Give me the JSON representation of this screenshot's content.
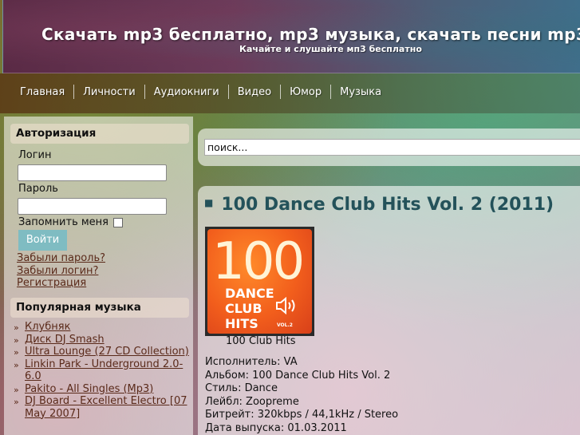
{
  "header": {
    "title": "Скачать mp3 бесплатно, mp3 музыка, скачать песни mp3",
    "subtitle": "Качайте и слушайте мп3 бесплатно"
  },
  "nav": [
    "Главная",
    "Личности",
    "Аудиокниги",
    "Видео",
    "Юмор",
    "Музыка"
  ],
  "auth": {
    "title": "Авторизация",
    "login_label": "Логин",
    "password_label": "Пароль",
    "remember_label": "Запомнить меня",
    "login_button": "Войти",
    "forgot_password": "Забыли пароль?",
    "forgot_login": "Забыли логин?",
    "register": "Регистрация"
  },
  "popular": {
    "title": "Популярная музыка",
    "items": [
      "Клубняк",
      "Диск DJ Smash",
      "Ultra Lounge (27 CD Collection)",
      "Linkin Park - Underground 2.0-6.0",
      "Pakito - All Singles (Mp3)",
      "DJ Board - Excellent Electro [07 May 2007]"
    ]
  },
  "search": {
    "value": "поиск..."
  },
  "article": {
    "title": "100 Dance Club Hits Vol. 2 (2011)",
    "cover": {
      "number": "100",
      "line1": "DANCE",
      "line2": "CLUB",
      "line3": "HITS",
      "vol": "VOL.2",
      "caption": "100 Club Hits"
    },
    "info": [
      "Исполнитель: VA",
      "Альбом: 100 Dance Club Hits Vol. 2",
      "Стиль: Dance",
      "Лейбл: Zoopreme",
      "Битрейт: 320kbps / 44,1kHz / Stereo",
      "Дата выпуска: 01.03.2011"
    ]
  }
}
